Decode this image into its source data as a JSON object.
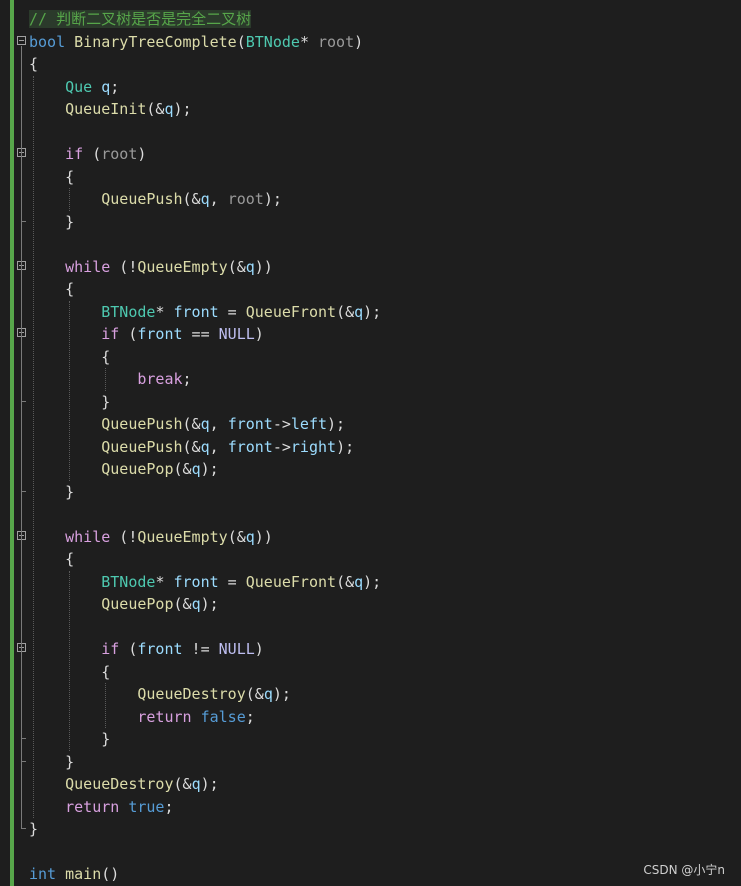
{
  "editor": {
    "language": "C",
    "theme": "dark",
    "watermark": "CSDN @小宁n",
    "colors": {
      "background": "#1e1e1e",
      "comment": "#57a64a",
      "keyword": "#569cd6",
      "control": "#d8a0df",
      "type": "#4ec9b0",
      "function": "#dcdcaa",
      "variable": "#9cdcfe",
      "parameter": "#9a9a9a",
      "macro": "#bebef0",
      "change_bar": "#57a64a"
    },
    "lines": [
      [
        {
          "t": "// 判断二叉树是否是完全二叉树",
          "c": "comment"
        }
      ],
      [
        {
          "t": "bool",
          "c": "kw"
        },
        {
          "t": " "
        },
        {
          "t": "BinaryTreeComplete",
          "c": "func"
        },
        {
          "t": "("
        },
        {
          "t": "BTNode",
          "c": "type"
        },
        {
          "t": "* "
        },
        {
          "t": "root",
          "c": "param"
        },
        {
          "t": ")"
        }
      ],
      [
        {
          "t": "{"
        }
      ],
      [
        {
          "t": "    "
        },
        {
          "t": "Que",
          "c": "type"
        },
        {
          "t": " "
        },
        {
          "t": "q",
          "c": "var"
        },
        {
          "t": ";"
        }
      ],
      [
        {
          "t": "    "
        },
        {
          "t": "QueueInit",
          "c": "func"
        },
        {
          "t": "(&"
        },
        {
          "t": "q",
          "c": "var"
        },
        {
          "t": ");"
        }
      ],
      [
        {
          "t": ""
        }
      ],
      [
        {
          "t": "    "
        },
        {
          "t": "if",
          "c": "ctrl"
        },
        {
          "t": " ("
        },
        {
          "t": "root",
          "c": "param"
        },
        {
          "t": ")"
        }
      ],
      [
        {
          "t": "    {"
        }
      ],
      [
        {
          "t": "        "
        },
        {
          "t": "QueuePush",
          "c": "func"
        },
        {
          "t": "(&"
        },
        {
          "t": "q",
          "c": "var"
        },
        {
          "t": ", "
        },
        {
          "t": "root",
          "c": "param"
        },
        {
          "t": ");"
        }
      ],
      [
        {
          "t": "    }"
        }
      ],
      [
        {
          "t": ""
        }
      ],
      [
        {
          "t": "    "
        },
        {
          "t": "while",
          "c": "ctrl"
        },
        {
          "t": " (!"
        },
        {
          "t": "QueueEmpty",
          "c": "func"
        },
        {
          "t": "(&"
        },
        {
          "t": "q",
          "c": "var"
        },
        {
          "t": "))"
        }
      ],
      [
        {
          "t": "    {"
        }
      ],
      [
        {
          "t": "        "
        },
        {
          "t": "BTNode",
          "c": "type"
        },
        {
          "t": "* "
        },
        {
          "t": "front",
          "c": "var"
        },
        {
          "t": " = "
        },
        {
          "t": "QueueFront",
          "c": "func"
        },
        {
          "t": "(&"
        },
        {
          "t": "q",
          "c": "var"
        },
        {
          "t": ");"
        }
      ],
      [
        {
          "t": "        "
        },
        {
          "t": "if",
          "c": "ctrl"
        },
        {
          "t": " ("
        },
        {
          "t": "front",
          "c": "var"
        },
        {
          "t": " == "
        },
        {
          "t": "NULL",
          "c": "macro"
        },
        {
          "t": ")"
        }
      ],
      [
        {
          "t": "        {"
        }
      ],
      [
        {
          "t": "            "
        },
        {
          "t": "break",
          "c": "ctrl"
        },
        {
          "t": ";"
        }
      ],
      [
        {
          "t": "        }"
        }
      ],
      [
        {
          "t": "        "
        },
        {
          "t": "QueuePush",
          "c": "func"
        },
        {
          "t": "(&"
        },
        {
          "t": "q",
          "c": "var"
        },
        {
          "t": ", "
        },
        {
          "t": "front",
          "c": "var"
        },
        {
          "t": "->"
        },
        {
          "t": "left",
          "c": "var"
        },
        {
          "t": ");"
        }
      ],
      [
        {
          "t": "        "
        },
        {
          "t": "QueuePush",
          "c": "func"
        },
        {
          "t": "(&"
        },
        {
          "t": "q",
          "c": "var"
        },
        {
          "t": ", "
        },
        {
          "t": "front",
          "c": "var"
        },
        {
          "t": "->"
        },
        {
          "t": "right",
          "c": "var"
        },
        {
          "t": ");"
        }
      ],
      [
        {
          "t": "        "
        },
        {
          "t": "QueuePop",
          "c": "func"
        },
        {
          "t": "(&"
        },
        {
          "t": "q",
          "c": "var"
        },
        {
          "t": ");"
        }
      ],
      [
        {
          "t": "    }"
        }
      ],
      [
        {
          "t": ""
        }
      ],
      [
        {
          "t": "    "
        },
        {
          "t": "while",
          "c": "ctrl"
        },
        {
          "t": " (!"
        },
        {
          "t": "QueueEmpty",
          "c": "func"
        },
        {
          "t": "(&"
        },
        {
          "t": "q",
          "c": "var"
        },
        {
          "t": "))"
        }
      ],
      [
        {
          "t": "    {"
        }
      ],
      [
        {
          "t": "        "
        },
        {
          "t": "BTNode",
          "c": "type"
        },
        {
          "t": "* "
        },
        {
          "t": "front",
          "c": "var"
        },
        {
          "t": " = "
        },
        {
          "t": "QueueFront",
          "c": "func"
        },
        {
          "t": "(&"
        },
        {
          "t": "q",
          "c": "var"
        },
        {
          "t": ");"
        }
      ],
      [
        {
          "t": "        "
        },
        {
          "t": "QueuePop",
          "c": "func"
        },
        {
          "t": "(&"
        },
        {
          "t": "q",
          "c": "var"
        },
        {
          "t": ");"
        }
      ],
      [
        {
          "t": ""
        }
      ],
      [
        {
          "t": "        "
        },
        {
          "t": "if",
          "c": "ctrl"
        },
        {
          "t": " ("
        },
        {
          "t": "front",
          "c": "var"
        },
        {
          "t": " != "
        },
        {
          "t": "NULL",
          "c": "macro"
        },
        {
          "t": ")"
        }
      ],
      [
        {
          "t": "        {"
        }
      ],
      [
        {
          "t": "            "
        },
        {
          "t": "QueueDestroy",
          "c": "func"
        },
        {
          "t": "(&"
        },
        {
          "t": "q",
          "c": "var"
        },
        {
          "t": ");"
        }
      ],
      [
        {
          "t": "            "
        },
        {
          "t": "return",
          "c": "ctrl"
        },
        {
          "t": " "
        },
        {
          "t": "false",
          "c": "kw"
        },
        {
          "t": ";"
        }
      ],
      [
        {
          "t": "        }"
        }
      ],
      [
        {
          "t": "    }"
        }
      ],
      [
        {
          "t": "    "
        },
        {
          "t": "QueueDestroy",
          "c": "func"
        },
        {
          "t": "(&"
        },
        {
          "t": "q",
          "c": "var"
        },
        {
          "t": ");"
        }
      ],
      [
        {
          "t": "    "
        },
        {
          "t": "return",
          "c": "ctrl"
        },
        {
          "t": " "
        },
        {
          "t": "true",
          "c": "kw"
        },
        {
          "t": ";"
        }
      ],
      [
        {
          "t": "}"
        }
      ],
      [
        {
          "t": ""
        }
      ],
      [
        {
          "t": "int",
          "c": "kw"
        },
        {
          "t": " "
        },
        {
          "t": "main",
          "c": "func"
        },
        {
          "t": "()"
        }
      ]
    ],
    "fold_markers_at_lines": [
      1,
      6,
      11,
      14,
      23,
      28
    ]
  }
}
